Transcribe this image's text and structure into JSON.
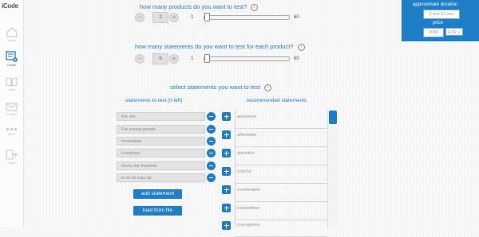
{
  "app": {
    "brand": "iCode",
    "brand_sub": ""
  },
  "sidebar": {
    "items": [
      {
        "label": "Home",
        "icon": "home-icon"
      },
      {
        "label": "Create",
        "icon": "create-icon"
      },
      {
        "label": "Help",
        "icon": "book-icon"
      },
      {
        "label": "Contact",
        "icon": "mail-icon"
      },
      {
        "label": "More",
        "icon": "more-icon"
      },
      {
        "label": "Logout",
        "icon": "logout-icon"
      }
    ]
  },
  "duration_panel": {
    "title": "approximate duration",
    "duration": "2 min 53 sec",
    "price_label": "price",
    "price": "1080",
    "currency": "EUR"
  },
  "products": {
    "question": "how many products do you want to test?",
    "value": "2",
    "min": "1",
    "max": "60"
  },
  "statements_count": {
    "question": "how many statements do you want to test for each product?",
    "value": "6",
    "min": "1",
    "max": "60"
  },
  "selection": {
    "heading": "select statements you want to test",
    "left_title": "statements to test (0 left)",
    "right_title": "recommended statements",
    "selected": [
      "For me",
      "For young people",
      "Innovative",
      "Luxurious",
      "Gives me freedom",
      "is on its way up"
    ],
    "recommended": [
      "advanced",
      "affordable",
      "attractive",
      "colorful",
      "comfortable",
      "competitive",
      "courageous"
    ],
    "add_button": "add statement",
    "load_button": "load from file"
  },
  "colors": {
    "accent": "#1e7ec8"
  }
}
